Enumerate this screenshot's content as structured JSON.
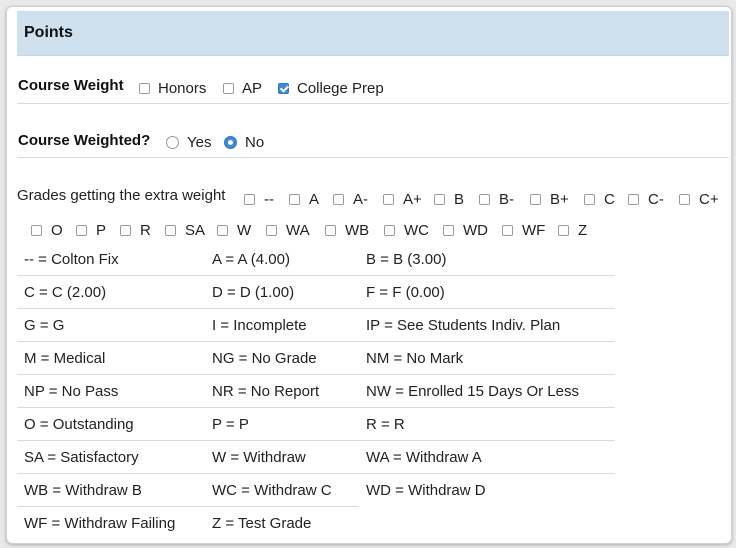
{
  "section": {
    "title": "Points"
  },
  "course_weight": {
    "label": "Course Weight",
    "options": [
      {
        "label": "Honors",
        "checked": false
      },
      {
        "label": "AP",
        "checked": false
      },
      {
        "label": "College Prep",
        "checked": true
      }
    ]
  },
  "course_weighted": {
    "label": "Course Weighted?",
    "options": [
      {
        "label": "Yes",
        "selected": false
      },
      {
        "label": "No",
        "selected": true
      }
    ]
  },
  "extra_weight": {
    "label": "Grades getting the extra weight",
    "grades": [
      "--",
      "A",
      "A-",
      "A+",
      "B",
      "B-",
      "B+",
      "C",
      "C-",
      "C+",
      "O",
      "P",
      "R",
      "SA",
      "W",
      "WA",
      "WB",
      "WC",
      "WD",
      "WF",
      "Z"
    ]
  },
  "legend": [
    [
      "-- = Colton Fix",
      "A = A (4.00)",
      "B = B (3.00)"
    ],
    [
      "C = C (2.00)",
      "D = D (1.00)",
      "F = F (0.00)"
    ],
    [
      "G = G",
      "I = Incomplete",
      "IP = See Students Indiv. Plan"
    ],
    [
      "M = Medical",
      "NG = No Grade",
      "NM = No Mark"
    ],
    [
      "NP = No Pass",
      "NR = No Report",
      "NW = Enrolled 15 Days Or Less"
    ],
    [
      "O = Outstanding",
      "P = P",
      "R = R"
    ],
    [
      "SA = Satisfactory",
      "W = Withdraw",
      "WA = Withdraw A"
    ],
    [
      "WB = Withdraw B",
      "WC = Withdraw C",
      "WD = Withdraw D"
    ],
    [
      "WF = Withdraw Failing",
      "Z = Test Grade",
      ""
    ]
  ]
}
